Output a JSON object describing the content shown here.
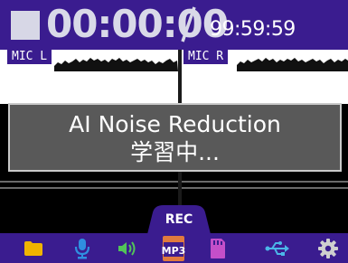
{
  "timer": {
    "elapsed": "00:00:00",
    "max": "99:59:59",
    "stop_icon": "stop-icon",
    "color_main": "#d9d9e8",
    "color_bar": "#3a1c8f"
  },
  "meters": {
    "left_label": "MIC L",
    "right_label": "MIC R"
  },
  "dialog": {
    "title": "AI Noise Reduction",
    "status": "学習中..."
  },
  "rec_tab": {
    "label": "REC"
  },
  "toolbar": {
    "items": [
      {
        "icon": "folder-icon",
        "color": "#f0b400"
      },
      {
        "icon": "microphone-icon",
        "color": "#2f8fe0"
      },
      {
        "icon": "speaker-icon",
        "color": "#52c458"
      },
      {
        "icon": "mp3-file-icon",
        "label": "MP3",
        "color": "#e07a3e"
      },
      {
        "icon": "sd-card-icon",
        "color": "#c44fc9"
      },
      {
        "icon": "usb-icon",
        "color": "#4bb6e8"
      },
      {
        "icon": "gear-icon",
        "color": "#cfcfcf"
      }
    ]
  }
}
